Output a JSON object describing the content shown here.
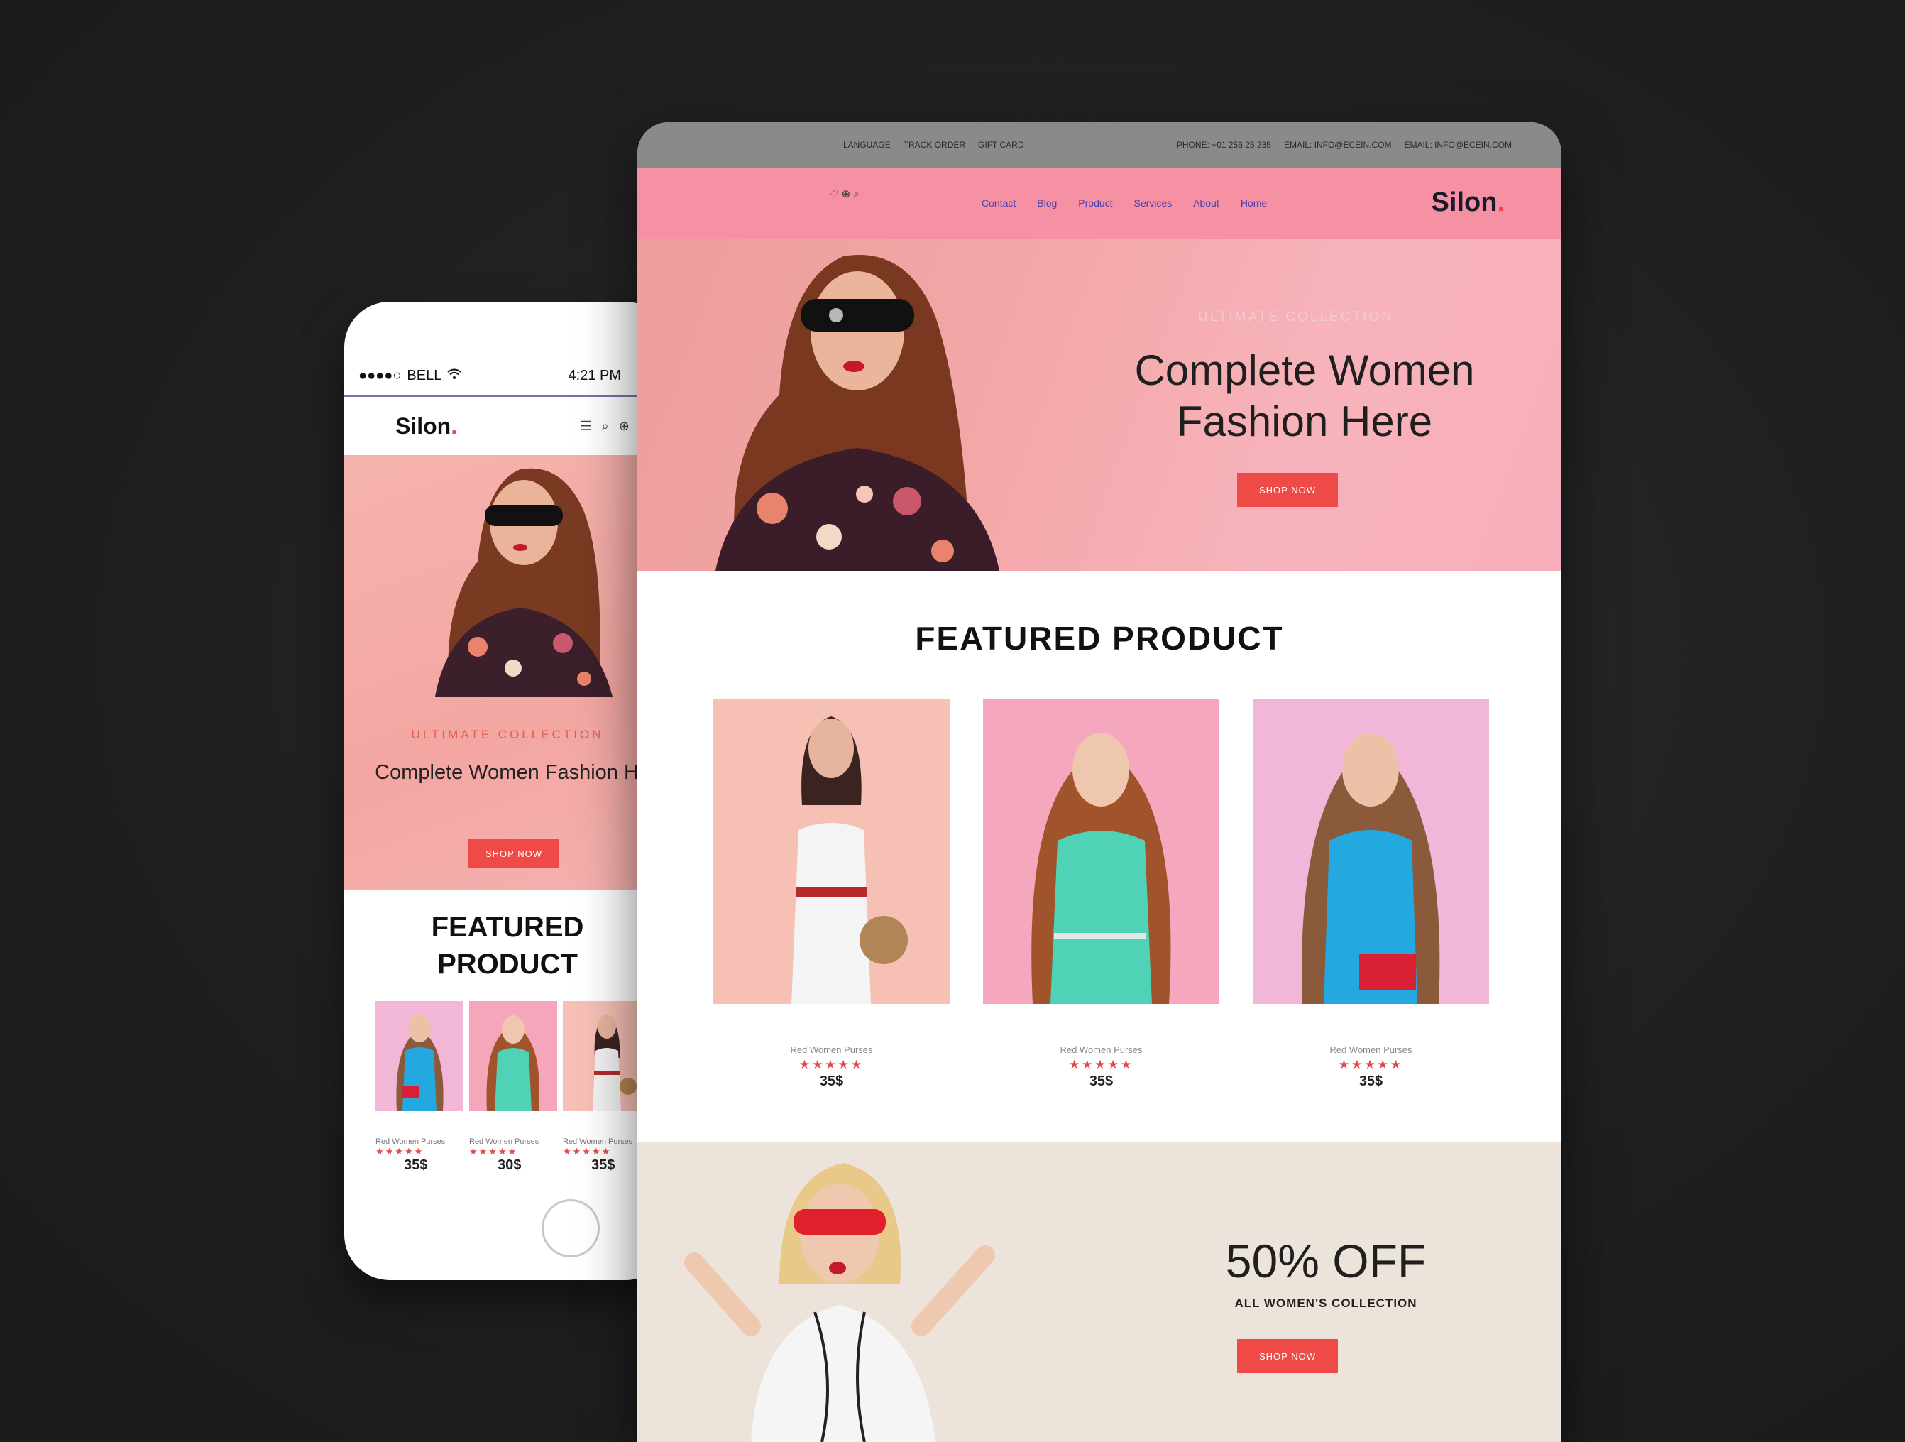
{
  "phone": {
    "status": {
      "carrier": "BELL",
      "time": "4:21 PM"
    },
    "logo": "Silon",
    "logo_dot": ".",
    "hero": {
      "subtitle": "ULTIMATE COLLECTION",
      "title": "Complete Women Fashion Here",
      "button": "SHOP NOW"
    },
    "featured_title": "FEATURED PRODUCT",
    "products": [
      {
        "name": "Red Women Purses",
        "stars": "★★★★★",
        "price": "35$"
      },
      {
        "name": "Red Women Purses",
        "stars": "★★★★★",
        "price": "30$"
      },
      {
        "name": "Red Women Purses",
        "stars": "★★★★★",
        "price": "35$"
      }
    ]
  },
  "desktop": {
    "topbar": {
      "left": [
        "LANGUAGE",
        "TRACK ORDER",
        "GIFT CARD"
      ],
      "right": [
        "PHONE: +01 256 25 235",
        "EMAIL: INFO@ECEIN.COM",
        "EMAIL: INFO@ECEIN.COM"
      ]
    },
    "nav": {
      "icons": "♡ ⊕ ⌕",
      "items": [
        "Contact",
        "Blog",
        "Product",
        "Services",
        "About",
        "Home"
      ],
      "logo": "Silon",
      "logo_dot": "."
    },
    "hero": {
      "subtitle": "ULTIMATE COLLECTION",
      "title": "Complete Women Fashion Here",
      "button": "SHOP NOW"
    },
    "featured_title": "FEATURED PRODUCT",
    "products": [
      {
        "name": "Red Women Purses",
        "stars": "★★★★★",
        "price": "35$"
      },
      {
        "name": "Red Women Purses",
        "stars": "★★★★★",
        "price": "35$"
      },
      {
        "name": "Red Women Purses",
        "stars": "★★★★★",
        "price": "35$"
      }
    ],
    "promo": {
      "title": "50% OFF",
      "subtitle": "ALL WOMEN'S COLLECTION",
      "button": "SHOP NOW"
    }
  },
  "colors": {
    "background": "#1f1f21",
    "nav_pink": "#f591a2",
    "hero_pink": "#f3a7a7",
    "accent_red": "#ef4a47",
    "promo_beige": "#ece3db"
  }
}
